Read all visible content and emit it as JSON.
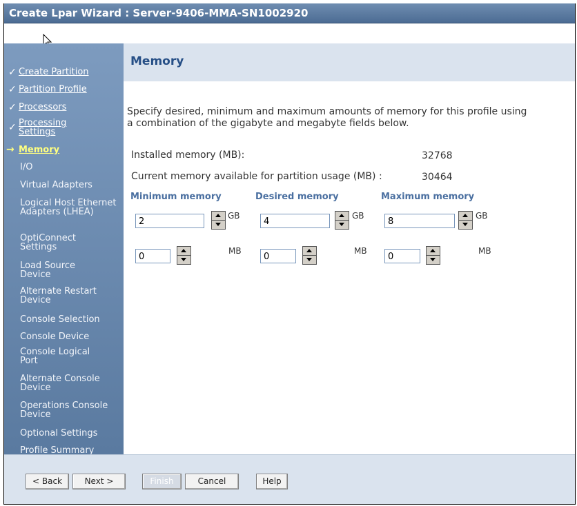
{
  "window": {
    "title": "Create Lpar Wizard : Server-9406-MMA-SN1002920"
  },
  "sidebar": {
    "items": [
      {
        "label": "Create Partition",
        "state": "done"
      },
      {
        "label": "Partition Profile",
        "state": "done"
      },
      {
        "label": "Processors",
        "state": "done"
      },
      {
        "label": "Processing Settings",
        "state": "done"
      },
      {
        "label": "Memory",
        "state": "current"
      },
      {
        "label": "I/O",
        "state": "todo"
      },
      {
        "label": "Virtual Adapters",
        "state": "todo"
      },
      {
        "label": "Logical Host Ethernet Adapters (LHEA)",
        "state": "todo"
      },
      {
        "label": "OptiConnect Settings",
        "state": "todo"
      },
      {
        "label": "Load Source Device",
        "state": "todo"
      },
      {
        "label": "Alternate Restart Device",
        "state": "todo"
      },
      {
        "label": "Console Selection",
        "state": "todo"
      },
      {
        "label": "Console Device",
        "state": "todo"
      },
      {
        "label": "Console Logical Port",
        "state": "todo"
      },
      {
        "label": "Alternate Console Device",
        "state": "todo"
      },
      {
        "label": "Operations Console Device",
        "state": "todo"
      },
      {
        "label": "Optional Settings",
        "state": "todo"
      },
      {
        "label": "Profile Summary",
        "state": "todo"
      }
    ],
    "done_mark": "✓",
    "current_mark": "→"
  },
  "main": {
    "heading": "Memory",
    "instructions_line1": "Specify desired, minimum and maximum amounts of memory for this profile using",
    "instructions_line2": "a combination of the gigabyte and megabyte fields below.",
    "installed_label": "Installed memory (MB):",
    "installed_value": "32768",
    "available_label": "Current memory available for partition usage (MB) :",
    "available_value": "30464",
    "columns": {
      "minimum": {
        "heading": "Minimum memory",
        "gb": "2",
        "mb": "0"
      },
      "desired": {
        "heading": "Desired memory",
        "gb": "4",
        "mb": "0"
      },
      "maximum": {
        "heading": "Maximum memory",
        "gb": "8",
        "mb": "0"
      }
    },
    "gb_unit": "GB",
    "mb_unit": "MB"
  },
  "buttons": {
    "back": "< Back",
    "next": "Next >",
    "finish": "Finish",
    "cancel": "Cancel",
    "help": "Help"
  },
  "colors": {
    "sidebar": "#6a8ab0",
    "heading_band": "#dae3ee",
    "current_item": "#ffff80"
  }
}
